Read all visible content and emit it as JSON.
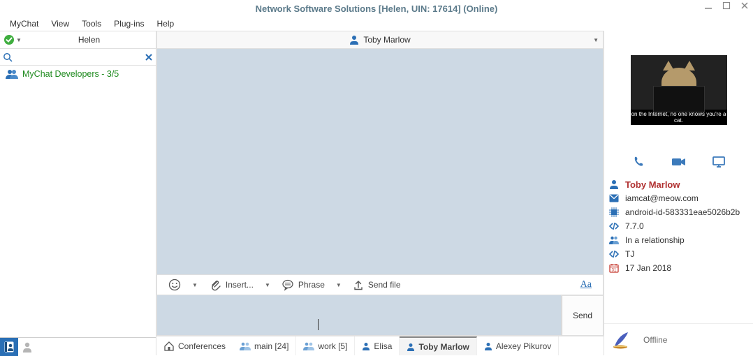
{
  "title": "Network Software Solutions [Helen, UIN: 17614] (Online)",
  "menu": [
    "MyChat",
    "View",
    "Tools",
    "Plug-ins",
    "Help"
  ],
  "status": {
    "name": "Helen"
  },
  "search": {
    "placeholder": ""
  },
  "contacts": {
    "group_label": "MyChat Developers - 3/5"
  },
  "chat": {
    "peer": "Toby Marlow",
    "toolbar": {
      "insert": "Insert...",
      "phrase": "Phrase",
      "sendfile": "Send file",
      "aa": "Aa"
    },
    "send": "Send",
    "tabs": {
      "conferences": "Conferences",
      "main": "main [24]",
      "work": "work [5]",
      "elisa": "Elisa",
      "toby": "Toby Marlow",
      "alexey": "Alexey Pikurov"
    }
  },
  "right": {
    "avatar_caption": "on the Internet, no one knows you're a cat.",
    "name": "Toby Marlow",
    "email": "iamcat@meow.com",
    "device": "android-id-583331eae5026b2b",
    "version": "7.7.0",
    "relationship": "In a relationship",
    "code": "TJ",
    "date": "17 Jan 2018",
    "presence": "Offline"
  }
}
